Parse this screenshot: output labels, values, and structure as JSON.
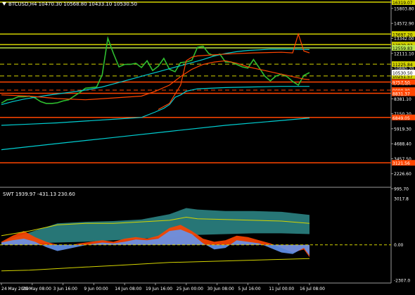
{
  "symbol_header": "BTCUSD,H4  10470.30 10568.80 10433.10 10530.50",
  "osc_header": "SWT 1939.97 -431.13 230.60",
  "chart_data": {
    "type": "line",
    "price_axis_ticks": [
      "16319.07",
      "15803.80",
      "14572.90",
      "13342.00",
      "12111.10",
      "10880.20",
      "9649.30",
      "8381.10",
      "7150.20",
      "5919.30",
      "4688.40",
      "3457.50",
      "2226.60",
      "995.70"
    ],
    "osc_axis_ticks": [
      "3017.8",
      "0.00",
      "-2307.0"
    ],
    "time_labels": [
      "24 May 2019",
      "29 May 08:00",
      "3 Jun 16:00",
      "9 Jun 00:00",
      "14 Jun 08:00",
      "19 Jun 16:00",
      "25 Jun 00:00",
      "30 Jun 08:00",
      "5 Jul 16:00",
      "11 Jul 00:00",
      "16 Jul 08:00"
    ],
    "ylim": [
      995.7,
      16319.07
    ],
    "osc_ylim": [
      -2307.0,
      3017.8
    ],
    "price_levels": [
      {
        "value": 16319.07,
        "label": "16319.07",
        "color": "#d4d400",
        "style": "solid",
        "text_color": "#000000"
      },
      {
        "value": 13697.2,
        "label": "13697.20",
        "color": "#d4d400",
        "style": "solid",
        "text_color": "#000000"
      },
      {
        "value": 12829.87,
        "label": "12829.87",
        "color": "#d4d400",
        "style": "solid",
        "text_color": "#000000"
      },
      {
        "value": 12559.83,
        "label": "12559.83",
        "color": "#b7e34b",
        "style": "solid",
        "text_color": "#000000"
      },
      {
        "value": 11225.84,
        "label": "11225.84",
        "color": "#d4d400",
        "style": "dashed",
        "text_color": "#000000"
      },
      {
        "value": 10251.57,
        "label": "10251.57",
        "color": "#d4d400",
        "style": "dashed",
        "text_color": "#000000"
      },
      {
        "value": 9757.5,
        "label": "9757.50",
        "color": "#ff4500",
        "style": "solid",
        "text_color": "#ffffff"
      },
      {
        "value": 9090.3,
        "label": "9090.30",
        "color": "#ff4500",
        "style": "dashed",
        "text_color": "#ffffff"
      },
      {
        "value": 8831.37,
        "label": "8831.37",
        "color": "#ff4500",
        "style": "solid",
        "text_color": "#ffffff"
      },
      {
        "value": 6849.05,
        "label": "6849.05",
        "color": "#ff4500",
        "style": "solid",
        "text_color": "#ffffff"
      },
      {
        "value": 3121.56,
        "label": "3121.56",
        "color": "#ff4500",
        "style": "solid",
        "text_color": "#ffffff"
      }
    ],
    "current_price": {
      "value": 10530.5,
      "label": "10530.50"
    },
    "series": [
      {
        "color": "#2fbf2f",
        "style": "price",
        "x": [
          0,
          2,
          4,
          6,
          8,
          10,
          12,
          14,
          16,
          18,
          20,
          22,
          24,
          26,
          28,
          30,
          32,
          34,
          36,
          38,
          40,
          42,
          44,
          46,
          48,
          50,
          52,
          54,
          56,
          58,
          60,
          62,
          64,
          66,
          68,
          70,
          72,
          74,
          76,
          78,
          80,
          82,
          84,
          86,
          88,
          90,
          92,
          94,
          96,
          98,
          100,
          102,
          104,
          106,
          108,
          110
        ],
        "values": [
          8020,
          8300,
          8350,
          8550,
          8550,
          8600,
          8450,
          8150,
          8000,
          8000,
          8050,
          8200,
          8300,
          8600,
          8900,
          9250,
          9300,
          9350,
          10350,
          13350,
          12100,
          11000,
          11200,
          11200,
          11300,
          10950,
          11500,
          10700,
          11050,
          11700,
          10800,
          10600,
          11350,
          11400,
          11550,
          12600,
          12700,
          12100,
          11900,
          12050,
          11400,
          11400,
          11200,
          11000,
          10900,
          11600,
          10950,
          10250,
          9850,
          10250,
          10400,
          10200,
          9800,
          9500,
          10300,
          10530
        ]
      },
      {
        "color": "#00ced1",
        "style": "solid",
        "x": [
          0,
          4,
          8,
          12,
          16,
          20,
          24,
          28,
          32,
          36,
          40,
          44,
          48,
          52,
          56,
          60,
          64,
          68,
          72,
          76,
          80,
          84,
          88,
          92,
          96,
          100,
          104,
          108,
          110
        ],
        "values": [
          7900,
          8150,
          8350,
          8500,
          8650,
          8780,
          8900,
          9030,
          9180,
          9350,
          9600,
          9850,
          10100,
          10350,
          10600,
          10850,
          11100,
          11350,
          11600,
          11900,
          12100,
          12250,
          12350,
          12400,
          12450,
          12450,
          12450,
          12430,
          12420
        ]
      },
      {
        "color": "#ff4500",
        "style": "solid",
        "x": [
          0,
          10,
          20,
          30,
          40,
          50,
          55,
          60,
          64,
          68,
          72,
          76,
          80,
          84,
          88,
          92,
          96,
          100,
          104,
          108,
          110
        ],
        "values": [
          8700,
          8600,
          8400,
          8300,
          8450,
          8600,
          9000,
          9500,
          10200,
          10800,
          11200,
          11400,
          11500,
          11300,
          11000,
          10800,
          10600,
          10400,
          10200,
          10000,
          9950
        ]
      },
      {
        "color": "#00ced1",
        "style": "solid",
        "x": [
          0,
          10,
          20,
          30,
          40,
          50,
          55,
          58,
          60,
          62,
          64,
          66,
          70,
          80,
          90,
          100,
          110
        ],
        "values": [
          6200,
          6300,
          6400,
          6550,
          6700,
          6850,
          7300,
          7600,
          7900,
          8500,
          8700,
          9000,
          9200,
          9300,
          9350,
          9400,
          9400
        ]
      },
      {
        "color": "#00ced1",
        "style": "solid",
        "x": [
          0,
          20,
          40,
          60,
          80,
          100,
          110
        ],
        "values": [
          4200,
          4700,
          5200,
          5700,
          6200,
          6600,
          6800
        ]
      },
      {
        "color": "#ff4500",
        "style": "solid",
        "x": [
          56,
          60,
          64,
          66,
          68,
          70,
          80,
          90,
          100,
          104,
          106,
          108,
          110
        ],
        "values": [
          7500,
          8000,
          9500,
          11500,
          11800,
          11900,
          12050,
          12150,
          12200,
          12150,
          13700,
          12300,
          12150
        ]
      }
    ],
    "osc_series": [
      {
        "name": "band",
        "color": "#2e8b8b",
        "x": [
          0,
          10,
          20,
          30,
          40,
          50,
          60,
          66,
          70,
          80,
          90,
          100,
          110
        ],
        "upper": [
          200,
          800,
          1400,
          1500,
          1550,
          1650,
          2000,
          2400,
          2300,
          2200,
          2200,
          2150,
          1950
        ],
        "lower": [
          150,
          100,
          150,
          200,
          300,
          400,
          500,
          600,
          650,
          700,
          750,
          750,
          700
        ]
      },
      {
        "name": "orange",
        "color": "#ff4500",
        "x": [
          0,
          4,
          8,
          12,
          16,
          20,
          24,
          28,
          32,
          36,
          40,
          44,
          48,
          52,
          56,
          60,
          64,
          68,
          72,
          76,
          80,
          84,
          88,
          92,
          96,
          100,
          104,
          108,
          110
        ],
        "values": [
          200,
          600,
          900,
          500,
          200,
          0,
          -50,
          100,
          200,
          300,
          200,
          400,
          500,
          400,
          600,
          1100,
          1300,
          900,
          400,
          200,
          300,
          600,
          500,
          300,
          100,
          -200,
          -500,
          -300,
          -800
        ]
      },
      {
        "name": "blue",
        "color": "#6495ed",
        "x": [
          0,
          4,
          8,
          12,
          16,
          20,
          24,
          28,
          32,
          36,
          40,
          44,
          48,
          52,
          56,
          60,
          64,
          68,
          72,
          76,
          80,
          84,
          88,
          92,
          96,
          100,
          104,
          108,
          110
        ],
        "values": [
          150,
          300,
          400,
          200,
          -150,
          -400,
          -250,
          -100,
          50,
          150,
          100,
          200,
          350,
          300,
          400,
          900,
          1000,
          700,
          100,
          -300,
          -200,
          300,
          200,
          100,
          -200,
          -500,
          -600,
          -200,
          -700
        ]
      },
      {
        "name": "yellow-upper",
        "color": "#d4d400",
        "x": [
          0,
          10,
          20,
          30,
          40,
          50,
          60,
          66,
          70,
          80,
          90,
          100,
          110
        ],
        "values": [
          600,
          900,
          1300,
          1400,
          1400,
          1500,
          1600,
          1800,
          1700,
          1650,
          1600,
          1550,
          1400
        ]
      },
      {
        "name": "yellow-lower",
        "color": "#d4d400",
        "x": [
          0,
          10,
          20,
          30,
          40,
          50,
          60,
          70,
          80,
          90,
          100,
          110
        ],
        "values": [
          -1700,
          -1650,
          -1550,
          -1450,
          -1350,
          -1250,
          -1150,
          -1100,
          -1050,
          -1000,
          -950,
          -900
        ]
      }
    ],
    "xlim": [
      0,
      110
    ],
    "xlabel": "",
    "ylabel": "",
    "grid": false,
    "legend": "none"
  }
}
